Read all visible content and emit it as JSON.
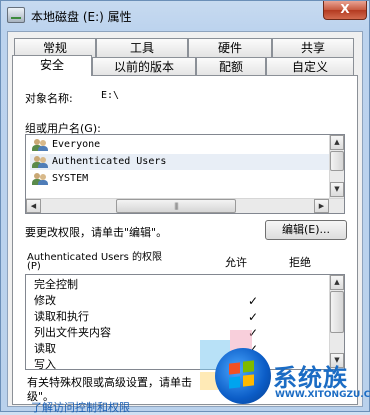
{
  "window": {
    "title": "本地磁盘 (E:) 属性",
    "close_label": "X"
  },
  "tabs_top": [
    "常规",
    "工具",
    "硬件",
    "共享"
  ],
  "tabs_bottom": [
    "安全",
    "以前的版本",
    "配额",
    "自定义"
  ],
  "active_tab": "安全",
  "object": {
    "label": "对象名称:",
    "value": "E:\\"
  },
  "groups": {
    "label": "组或用户名(G):",
    "items": [
      "Everyone",
      "Authenticated Users",
      "SYSTEM"
    ],
    "selected": "Authenticated Users"
  },
  "edit": {
    "hint": "要更改权限，请单击\"编辑\"。",
    "button": "编辑(E)..."
  },
  "permissions": {
    "title": "Authenticated Users 的权限",
    "title_suffix": "(P)",
    "allow_label": "允许",
    "deny_label": "拒绝",
    "items": [
      {
        "name": "完全控制",
        "allow": "",
        "deny": ""
      },
      {
        "name": "修改",
        "allow": "✓",
        "deny": ""
      },
      {
        "name": "读取和执行",
        "allow": "✓",
        "deny": ""
      },
      {
        "name": "列出文件夹内容",
        "allow": "✓",
        "deny": ""
      },
      {
        "name": "读取",
        "allow": "✓",
        "deny": ""
      },
      {
        "name": "写入",
        "allow": "✓",
        "deny": ""
      }
    ]
  },
  "special": {
    "line1": "有关特殊权限或高级设置，请单击",
    "line2": "级\"。"
  },
  "link": {
    "text": "了解访问控制和权限"
  },
  "watermark": {
    "brand": "系统族",
    "url": "WWW.XITONGZU.COM"
  },
  "colors": {
    "accent": "#1b6cc4",
    "close": "#c75a3f"
  }
}
